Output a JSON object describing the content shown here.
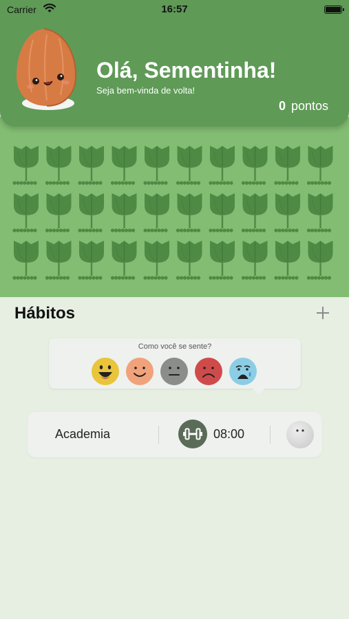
{
  "status_bar": {
    "carrier": "Carrier",
    "time": "16:57"
  },
  "header": {
    "greeting": "Olá, Sementinha!",
    "subtitle": "Seja bem-vinda de volta!",
    "points_value": "0",
    "points_label": "pontos"
  },
  "garden": {
    "rows": 3,
    "columns": 10,
    "plant_icon": "tulip-sprout-icon"
  },
  "habits": {
    "title": "Hábitos",
    "add_icon": "plus-icon",
    "mood_prompt": {
      "question": "Como você se sente?",
      "options": [
        {
          "name": "very-happy",
          "color": "#e8c53a"
        },
        {
          "name": "happy",
          "color": "#f0a27b"
        },
        {
          "name": "neutral",
          "color": "#8b8d8a"
        },
        {
          "name": "sad",
          "color": "#cf4b4b"
        },
        {
          "name": "scared",
          "color": "#8ccde6"
        }
      ]
    },
    "items": [
      {
        "name": "Academia",
        "icon": "dumbbell-icon",
        "time": "08:00",
        "mood_icon": "blank-mood-face-icon"
      }
    ]
  },
  "colors": {
    "header_green": "#5f9a57",
    "garden_green": "#83bd73",
    "background": "#e6efe2"
  }
}
